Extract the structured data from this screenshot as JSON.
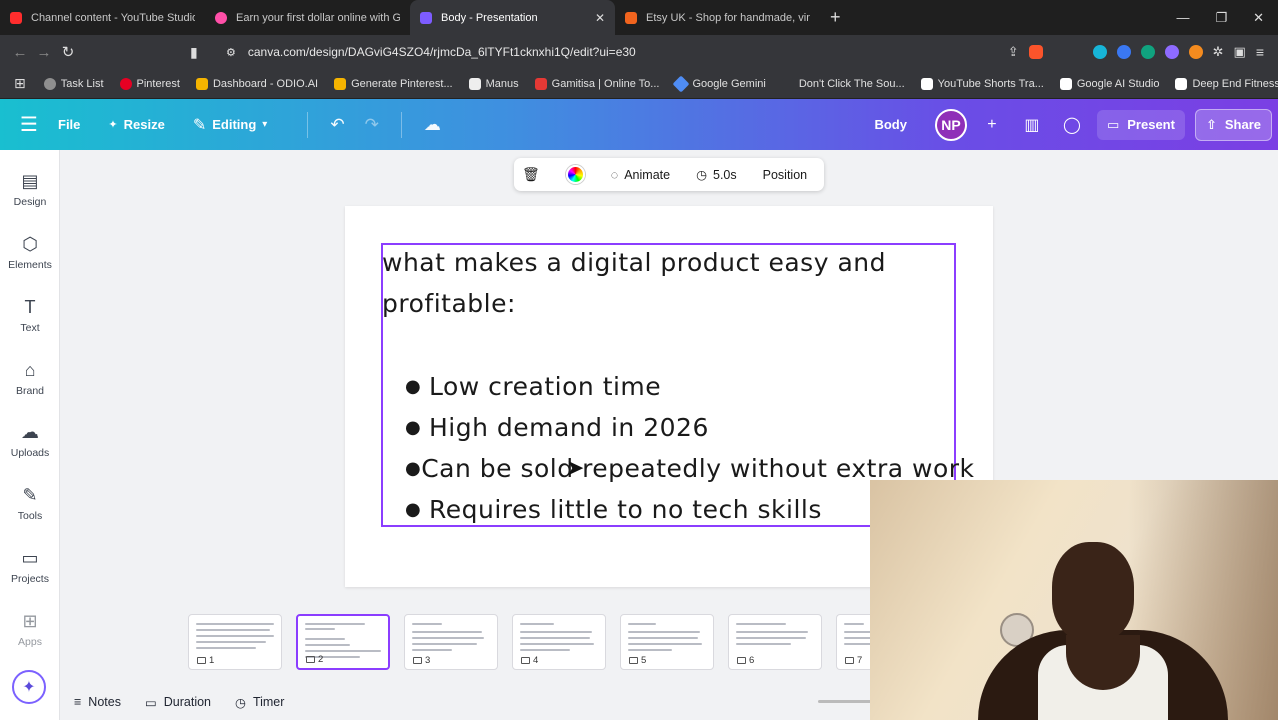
{
  "browser": {
    "tabs": [
      {
        "label": "Channel content - YouTube Studio",
        "color": "#ff2d2d"
      },
      {
        "label": "Earn your first dollar online with Gum",
        "color": "#ff4fa8"
      },
      {
        "label": "Body - Presentation",
        "color": "#7d5cff",
        "active": true
      },
      {
        "label": "Etsy UK - Shop for handmade, vintage",
        "color": "#f1641e"
      }
    ],
    "url": "canva.com/design/DAGviG4SZO4/rjmcDa_6lTYFt1cknxhi1Q/edit?ui=e30",
    "bookmarks": [
      {
        "label": "Task List",
        "color": "#8f8f8f"
      },
      {
        "label": "Pinterest",
        "color": "#e60023"
      },
      {
        "label": "Dashboard - ODIO.AI",
        "color": "#f5b400"
      },
      {
        "label": "Generate Pinterest...",
        "color": "#f5b400"
      },
      {
        "label": "Manus",
        "color": "#eeeeee"
      },
      {
        "label": "Gamitisa | Online To...",
        "color": "#e53935"
      },
      {
        "label": "Google Gemini",
        "color": "#4f8df5"
      },
      {
        "label": "Don't Click The Sou...",
        "color": "#35363a"
      },
      {
        "label": "YouTube Shorts Tra...",
        "color": "#ffffff"
      },
      {
        "label": "Google AI Studio",
        "color": "#ffffff"
      },
      {
        "label": "Deep End Fitness (...",
        "color": "#ffffff"
      }
    ]
  },
  "canva": {
    "file_label": "File",
    "resize_label": "Resize",
    "editing_label": "Editing",
    "doc_title": "Body",
    "avatar_initials": "NP",
    "present_label": "Present",
    "share_label": "Share",
    "accent_color": "#8b3dff"
  },
  "rail": [
    {
      "label": "Design",
      "icon": "design-icon"
    },
    {
      "label": "Elements",
      "icon": "elements-icon"
    },
    {
      "label": "Text",
      "icon": "text-icon"
    },
    {
      "label": "Brand",
      "icon": "brand-icon"
    },
    {
      "label": "Uploads",
      "icon": "uploads-icon"
    },
    {
      "label": "Tools",
      "icon": "tools-icon"
    },
    {
      "label": "Projects",
      "icon": "projects-icon"
    },
    {
      "label": "Apps",
      "icon": "apps-icon"
    }
  ],
  "context_toolbar": {
    "animate_label": "Animate",
    "duration_label": "5.0s",
    "position_label": "Position"
  },
  "slide": {
    "heading": "what makes a digital product easy and profitable:",
    "bullets": [
      "Low creation time",
      "High demand in 2026",
      "Can be sold repeatedly without extra work",
      "Requires little to no tech skills"
    ]
  },
  "thumbnails": [
    {
      "number": "1"
    },
    {
      "number": "2",
      "selected": true
    },
    {
      "number": "3"
    },
    {
      "number": "4"
    },
    {
      "number": "5"
    },
    {
      "number": "6"
    },
    {
      "number": "7"
    }
  ],
  "bottom_bar": {
    "notes_label": "Notes",
    "duration_label": "Duration",
    "timer_label": "Timer"
  }
}
